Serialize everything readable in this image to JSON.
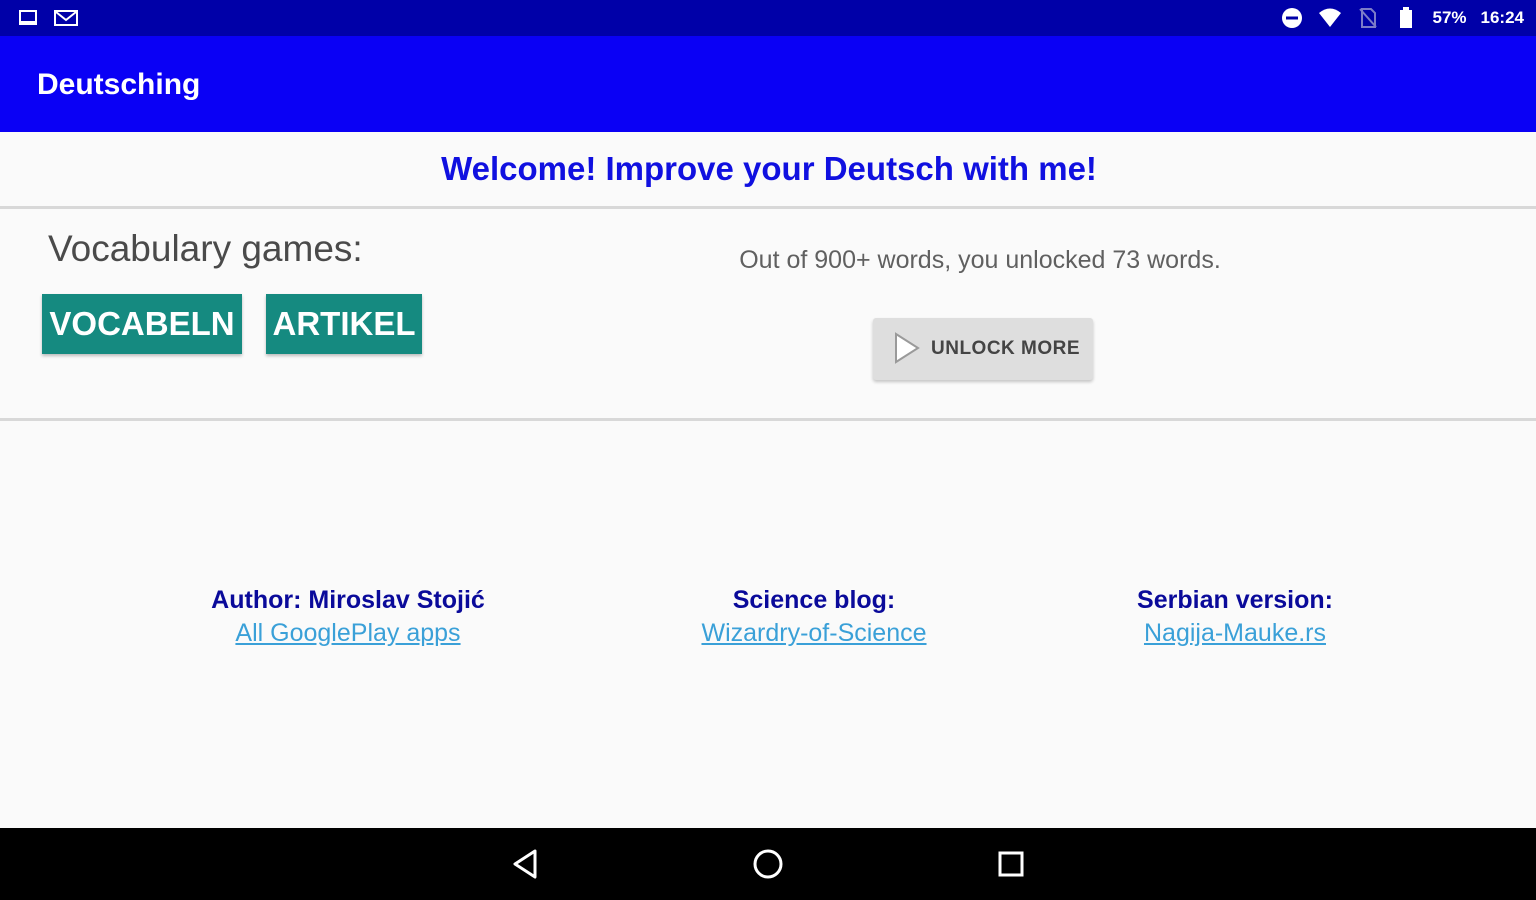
{
  "status_bar": {
    "left_icons": [
      "screen-icon",
      "gmail-icon"
    ],
    "right_icons": [
      "do-not-disturb-icon",
      "wifi-icon",
      "no-sim-icon",
      "battery-icon"
    ],
    "battery": "57%",
    "time": "16:24"
  },
  "app_bar": {
    "title": "Deutsching"
  },
  "welcome": {
    "text": "Welcome! Improve your Deutsch with me!"
  },
  "games": {
    "heading": "Vocabulary games:",
    "buttons": [
      "VOCABELN",
      "ARTIKEL"
    ]
  },
  "unlock": {
    "info": "Out of 900+ words, you unlocked 73 words.",
    "button_label": "UNLOCK MORE",
    "button_icon": "play-icon"
  },
  "footer": {
    "author_heading": "Author: Miroslav Stojić",
    "author_link": "All GooglePlay apps",
    "blog_heading": "Science blog:",
    "blog_link": "Wizardry-of-Science",
    "serbian_heading": "Serbian version:",
    "serbian_link": "Nagija-Mauke.rs"
  },
  "nav_bar": {
    "buttons": [
      "back-icon",
      "home-icon",
      "recents-icon"
    ]
  },
  "colors": {
    "status_bar": "#0000a8",
    "app_bar": "#0a00f5",
    "welcome_text": "#1010e0",
    "game_button": "#158a80",
    "link": "#3aa0d8"
  }
}
